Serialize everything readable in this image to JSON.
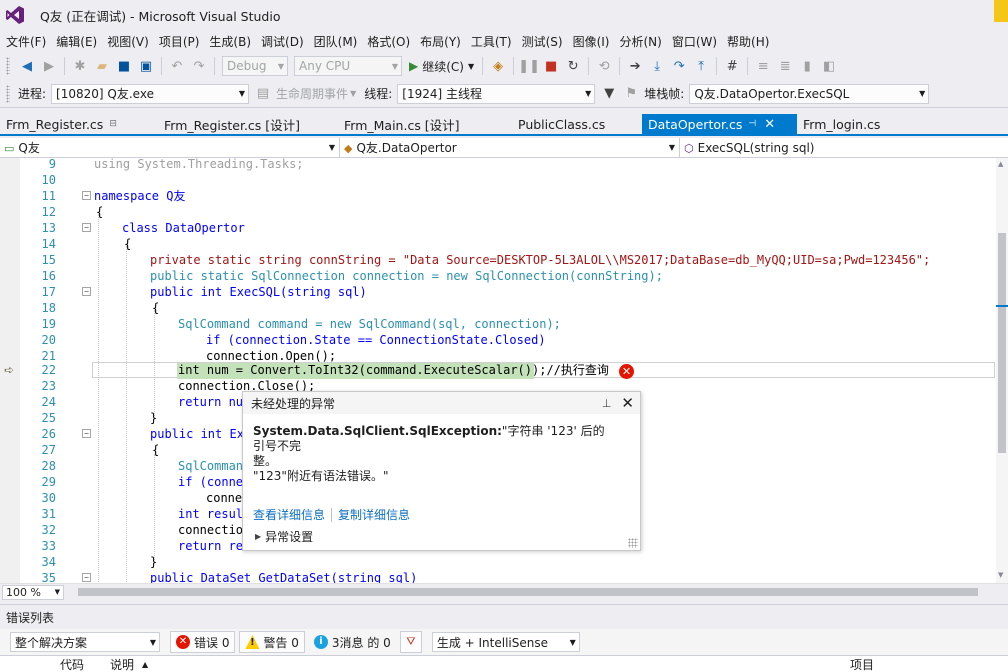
{
  "window": {
    "title": "Q友 (正在调试) - Microsoft Visual Studio"
  },
  "menu": [
    "文件(F)",
    "编辑(E)",
    "视图(V)",
    "项目(P)",
    "生成(B)",
    "调试(D)",
    "团队(M)",
    "格式(O)",
    "布局(Y)",
    "工具(T)",
    "测试(S)",
    "图像(I)",
    "分析(N)",
    "窗口(W)",
    "帮助(H)"
  ],
  "toolbar1": {
    "config": "Debug",
    "platform": "Any CPU",
    "continue_label": "继续(C)"
  },
  "toolbar2": {
    "process_label": "进程:",
    "process_value": "[10820] Q友.exe",
    "lifecycle_label": "生命周期事件",
    "thread_label": "线程:",
    "thread_value": "[1924] 主线程",
    "stackframe_label": "堆栈帧:",
    "stackframe_value": "Q友.DataOpertor.ExecSQL"
  },
  "tabs": [
    {
      "label": "Frm_Register.cs",
      "pinned": true,
      "active": false
    },
    {
      "label": "Frm_Register.cs [设计]",
      "pinned": false,
      "active": false
    },
    {
      "label": "Frm_Main.cs [设计]",
      "pinned": false,
      "active": false
    },
    {
      "label": "PublicClass.cs",
      "pinned": false,
      "active": false
    },
    {
      "label": "DataOpertor.cs",
      "pinned": true,
      "active": true
    },
    {
      "label": "Frm_login.cs",
      "pinned": false,
      "active": false
    }
  ],
  "navbar": {
    "project": "Q友",
    "class": "Q友.DataOpertor",
    "member": "ExecSQL(string sql)"
  },
  "code_lines": [
    {
      "n": "9",
      "text": "using System.Threading.Tasks;"
    },
    {
      "n": "10",
      "text": ""
    },
    {
      "n": "11",
      "text": "namespace Q友"
    },
    {
      "n": "12",
      "text": "{"
    },
    {
      "n": "13",
      "text": "class DataOpertor"
    },
    {
      "n": "14",
      "text": "{"
    },
    {
      "n": "15",
      "text": "private static string connString = \"Data Source=DESKTOP-5L3ALOL\\\\MS2017;DataBase=db_MyQQ;UID=sa;Pwd=123456\";"
    },
    {
      "n": "16",
      "text": "public static SqlConnection connection = new SqlConnection(connString);"
    },
    {
      "n": "17",
      "text": "public int ExecSQL(string sql)"
    },
    {
      "n": "18",
      "text": "{"
    },
    {
      "n": "19",
      "text": "SqlCommand command = new SqlCommand(sql, connection);"
    },
    {
      "n": "20",
      "text": "if (connection.State == ConnectionState.Closed)"
    },
    {
      "n": "21",
      "text": "connection.Open();"
    },
    {
      "n": "22",
      "text": "int num = Convert.ToInt32(command.ExecuteScalar());//执行查询"
    },
    {
      "n": "23",
      "text": "connection.Close();"
    },
    {
      "n": "24",
      "text": "return nu"
    },
    {
      "n": "25",
      "text": "}"
    },
    {
      "n": "26",
      "text": "public int Ex"
    },
    {
      "n": "27",
      "text": "{"
    },
    {
      "n": "28",
      "text": "SqlComman"
    },
    {
      "n": "29",
      "text": "if (conne"
    },
    {
      "n": "30",
      "text": "conne"
    },
    {
      "n": "31",
      "text": "int resul"
    },
    {
      "n": "32",
      "text": "connectio"
    },
    {
      "n": "33",
      "text": "return re"
    },
    {
      "n": "34",
      "text": "}"
    },
    {
      "n": "35",
      "text": "public DataSet GetDataSet(string sql)"
    }
  ],
  "exception": {
    "title": "未经处理的异常",
    "type": "System.Data.SqlClient.SqlException:",
    "message_line1": "\"字符串 '123' 后的引号不完",
    "message_line2": "整。",
    "message_line3": "\"123\"附近有语法错误。\"",
    "link_details": "查看详细信息",
    "link_copy": "复制详细信息",
    "settings": "异常设置"
  },
  "zoom": "100 %",
  "error_list": {
    "title": "错误列表",
    "scope": "整个解决方案",
    "errors": "错误 0",
    "warnings": "警告 0",
    "messages": "3消息 的 0",
    "build_filter": "生成 + IntelliSense",
    "col_code": "代码",
    "col_desc": "说明",
    "col_project": "项目"
  }
}
